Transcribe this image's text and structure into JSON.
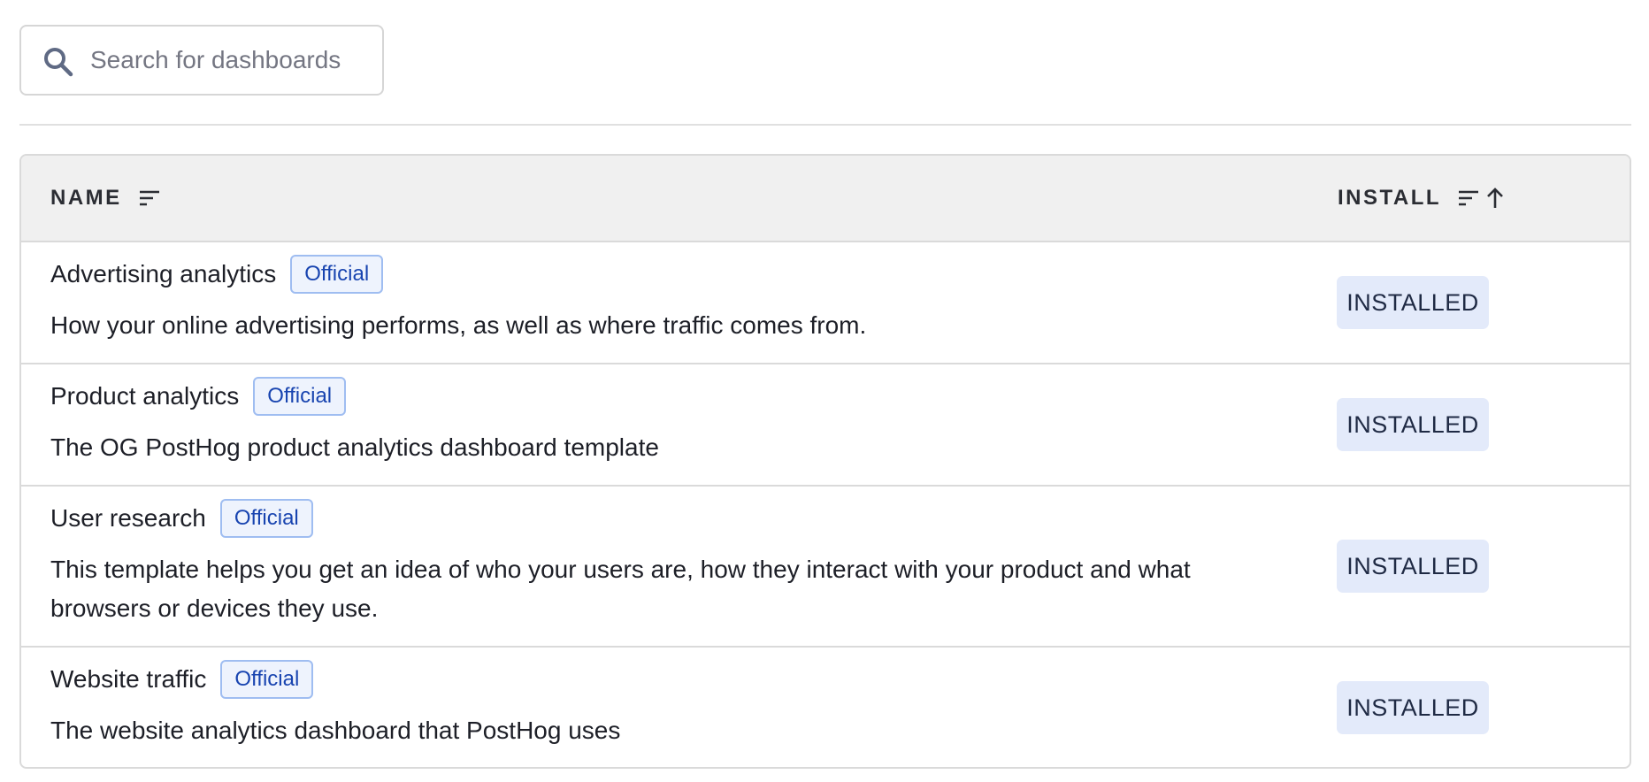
{
  "search": {
    "placeholder": "Search for dashboards",
    "value": ""
  },
  "table": {
    "columns": [
      {
        "label": "NAME"
      },
      {
        "label": "INSTALL"
      }
    ],
    "rows": [
      {
        "name": "Advertising analytics",
        "badge": "Official",
        "description": "How your online advertising performs, as well as where traffic comes from.",
        "status": "INSTALLED"
      },
      {
        "name": "Product analytics",
        "badge": "Official",
        "description": "The OG PostHog product analytics dashboard template",
        "status": "INSTALLED"
      },
      {
        "name": "User research",
        "badge": "Official",
        "description": "This template helps you get an idea of who your users are, how they interact with your product and what browsers or devices they use.",
        "status": "INSTALLED"
      },
      {
        "name": "Website traffic",
        "badge": "Official",
        "description": "The website analytics dashboard that PostHog uses",
        "status": "INSTALLED"
      }
    ]
  },
  "icons": {
    "search": "search-icon",
    "sort": "sort-icon",
    "sort_ascending": "arrow-up-icon"
  },
  "colors": {
    "badge_border": "#9fbdf1",
    "badge_text": "#1844b0",
    "installed_bg": "#e3eafa",
    "header_bg": "#f0f0f0"
  }
}
